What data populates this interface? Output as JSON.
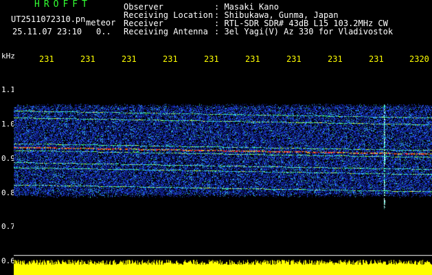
{
  "header": {
    "title": "HROFFT",
    "filename": "UT2511072310.pn",
    "mode": "meteor",
    "datetime": "25.11.07 23:10",
    "counter": "0.."
  },
  "info": {
    "labels": [
      "Observer",
      "Receiving Location",
      "Receiver",
      "Receiving Antenna"
    ],
    "values": [
      ": Masaki Kano",
      ": Shibukawa, Gunma, Japan",
      ": RTL-SDR SDR# 43dB L15 103.2MHz CW",
      ": 3el Yagi(V) Az 330 for Vladivostok"
    ]
  },
  "y_axis": {
    "unit": "kHz",
    "ticks": [
      "1.1",
      "1.0",
      "0.9",
      "0.8",
      "0.7",
      "0.6"
    ]
  },
  "x_axis": {
    "ticks": [
      "231",
      "231",
      "231",
      "231",
      "231",
      "231",
      "231",
      "231",
      "231",
      "2320"
    ]
  },
  "colors": {
    "background": "#000000",
    "header_green": "#33ff33",
    "label_yellow": "#ffff00",
    "signal_red": "#ff3030",
    "noise_blue": "#2040ff"
  },
  "spectrogram": {
    "freq_range_khz": [
      0.6,
      1.1
    ],
    "lines_khz": [
      1.04,
      1.02,
      0.945,
      0.935,
      0.925,
      0.89,
      0.875,
      0.825
    ],
    "meteor_column_fraction": 0.885
  }
}
